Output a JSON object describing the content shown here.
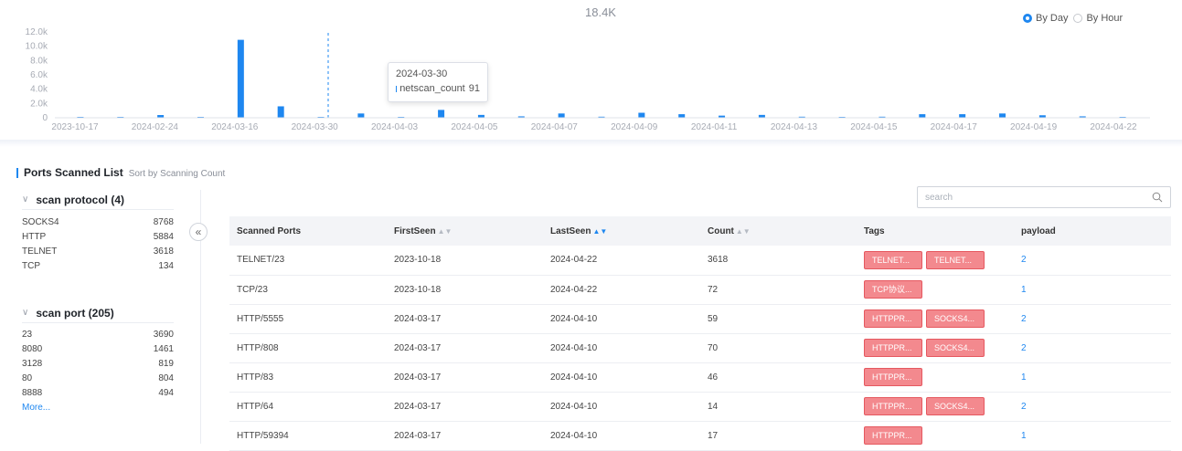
{
  "chart": {
    "peak_label": "18.4K",
    "toggle": {
      "by_day": "By Day",
      "by_hour": "By Hour",
      "selected": "By Day"
    },
    "tooltip": {
      "date": "2024-03-30",
      "series": "netscan_count",
      "value": "91"
    },
    "bar_color": "#1e87f0"
  },
  "chart_data": {
    "type": "bar",
    "ylim": [
      0,
      12000
    ],
    "yticks": [
      "0",
      "2.0k",
      "4.0k",
      "6.0k",
      "8.0k",
      "10.0k",
      "12.0k"
    ],
    "ytick_values": [
      0,
      2000,
      4000,
      6000,
      8000,
      10000,
      12000
    ],
    "xticks": [
      "2023-10-17",
      "2024-02-24",
      "2024-03-16",
      "2024-03-30",
      "2024-04-03",
      "2024-04-05",
      "2024-04-07",
      "2024-04-09",
      "2024-04-11",
      "2024-04-13",
      "2024-04-15",
      "2024-04-17",
      "2024-04-19",
      "2024-04-22"
    ],
    "values": [
      20,
      20,
      380,
      20,
      10900,
      1600,
      91,
      600,
      90,
      1100,
      400,
      200,
      600,
      150,
      700,
      500,
      300,
      400,
      150,
      100,
      150,
      500,
      500,
      600,
      350,
      200,
      100
    ],
    "highlight_index": 7
  },
  "section": {
    "title": "Ports Scanned List",
    "subtitle": "Sort by Scanning Count"
  },
  "filters": {
    "protocol": {
      "title": "scan protocol (4)",
      "items": [
        {
          "name": "SOCKS4",
          "count": "8768"
        },
        {
          "name": "HTTP",
          "count": "5884"
        },
        {
          "name": "TELNET",
          "count": "3618"
        },
        {
          "name": "TCP",
          "count": "134"
        }
      ]
    },
    "port": {
      "title": "scan port (205)",
      "items": [
        {
          "name": "23",
          "count": "3690"
        },
        {
          "name": "8080",
          "count": "1461"
        },
        {
          "name": "3128",
          "count": "819"
        },
        {
          "name": "80",
          "count": "804"
        },
        {
          "name": "8888",
          "count": "494"
        }
      ],
      "more": "More..."
    }
  },
  "search": {
    "placeholder": "search"
  },
  "table": {
    "headers": [
      "Scanned Ports",
      "FirstSeen",
      "LastSeen",
      "Count",
      "Tags",
      "payload"
    ],
    "rows": [
      {
        "port": "TELNET/23",
        "first": "2023-10-18",
        "last": "2024-04-22",
        "count": "3618",
        "tags": [
          "TELNET...",
          "TELNET..."
        ],
        "payload": "2"
      },
      {
        "port": "TCP/23",
        "first": "2023-10-18",
        "last": "2024-04-22",
        "count": "72",
        "tags": [
          "TCP协议..."
        ],
        "payload": "1"
      },
      {
        "port": "HTTP/5555",
        "first": "2024-03-17",
        "last": "2024-04-10",
        "count": "59",
        "tags": [
          "HTTPPR...",
          "SOCKS4..."
        ],
        "payload": "2"
      },
      {
        "port": "HTTP/808",
        "first": "2024-03-17",
        "last": "2024-04-10",
        "count": "70",
        "tags": [
          "HTTPPR...",
          "SOCKS4..."
        ],
        "payload": "2"
      },
      {
        "port": "HTTP/83",
        "first": "2024-03-17",
        "last": "2024-04-10",
        "count": "46",
        "tags": [
          "HTTPPR..."
        ],
        "payload": "1"
      },
      {
        "port": "HTTP/64",
        "first": "2024-03-17",
        "last": "2024-04-10",
        "count": "14",
        "tags": [
          "HTTPPR...",
          "SOCKS4..."
        ],
        "payload": "2"
      },
      {
        "port": "HTTP/59394",
        "first": "2024-03-17",
        "last": "2024-04-10",
        "count": "17",
        "tags": [
          "HTTPPR..."
        ],
        "payload": "1"
      }
    ]
  }
}
